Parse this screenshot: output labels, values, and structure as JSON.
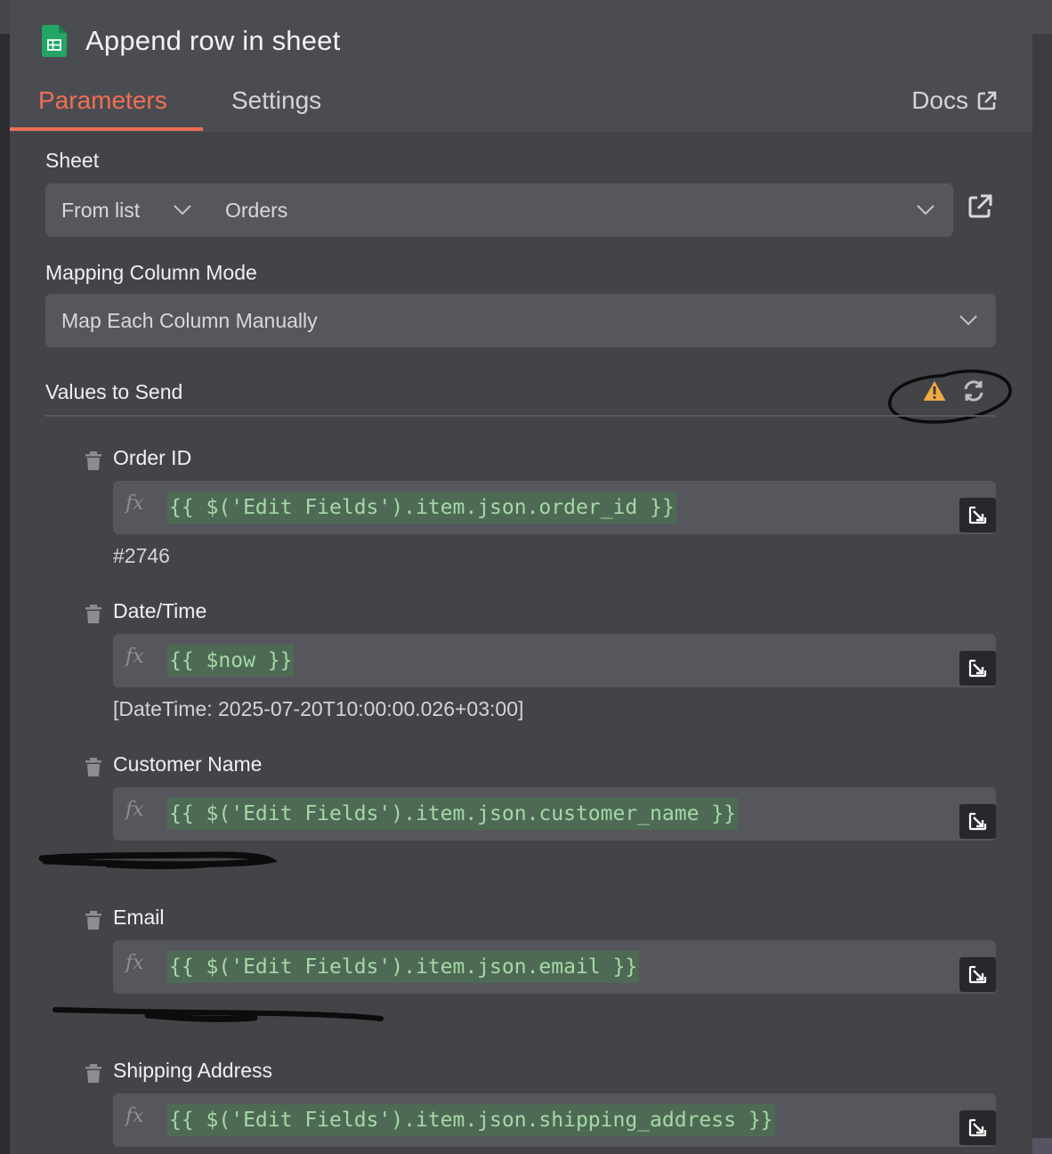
{
  "header": {
    "title": "Append row in sheet",
    "tabs": [
      {
        "label": "Parameters",
        "active": true
      },
      {
        "label": "Settings",
        "active": false
      }
    ],
    "docs_label": "Docs"
  },
  "sheet": {
    "label": "Sheet",
    "mode_value": "From list",
    "sheet_value": "Orders"
  },
  "mapping": {
    "label": "Mapping Column Mode",
    "value": "Map Each Column Manually"
  },
  "values": {
    "label": "Values to Send",
    "fields": [
      {
        "name": "Order ID",
        "expression": "{{ $('Edit Fields').item.json.order_id }}",
        "result": "#2746"
      },
      {
        "name": "Date/Time",
        "expression": "{{ $now }}",
        "result": "[DateTime: 2025-07-20T10:00:00.026+03:00]"
      },
      {
        "name": "Customer Name",
        "expression": "{{ $('Edit Fields').item.json.customer_name }}",
        "result": ""
      },
      {
        "name": "Email",
        "expression": "{{ $('Edit Fields').item.json.email }}",
        "result": ""
      },
      {
        "name": "Shipping Address",
        "expression": "{{ $('Edit Fields').item.json.shipping_address }}",
        "result": ""
      }
    ]
  },
  "fx_label": "fx",
  "colors": {
    "accent": "#ef6f54",
    "expression_text": "#a6d8a6",
    "warning": "#f0a945",
    "sheets_green": "#23a566"
  },
  "icons": [
    "google-sheets-icon",
    "external-link-icon",
    "chevron-down-icon",
    "warning-icon",
    "refresh-icon",
    "trash-icon",
    "expand-icon"
  ]
}
